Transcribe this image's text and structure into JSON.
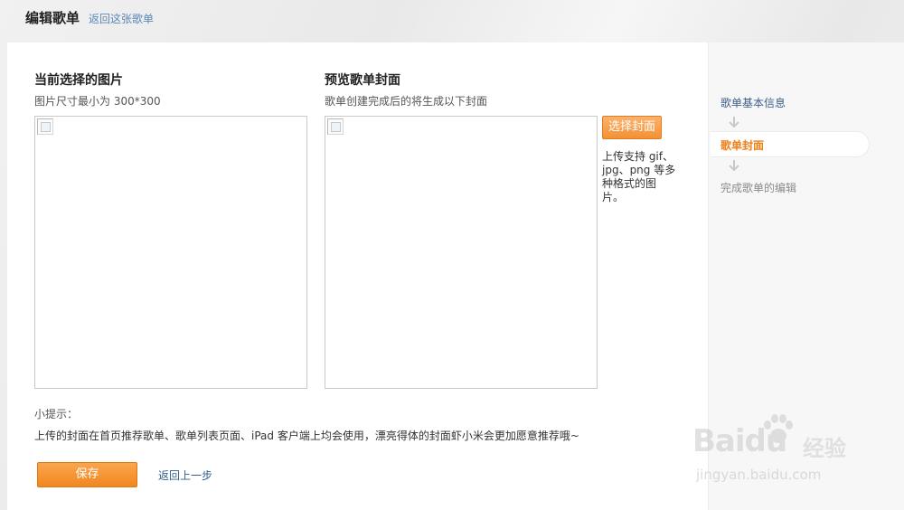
{
  "header": {
    "title": "编辑歌单",
    "back_link": "返回这张歌单"
  },
  "left_panel": {
    "title": "当前选择的图片",
    "subtitle": "图片尺寸最小为 300*300"
  },
  "right_panel": {
    "title": "预览歌单封面",
    "subtitle": "歌单创建完成后的将生成以下封面",
    "choose_button": "选择封面",
    "upload_note": "上传支持 gif、jpg、png 等多种格式的图片。"
  },
  "tips": {
    "label": "小提示：",
    "text": "上传的封面在首页推荐歌单、歌单列表页面、iPad 客户端上均会使用，漂亮得体的封面虾小米会更加愿意推荐哦~"
  },
  "actions": {
    "save": "保存",
    "back": "返回上一步"
  },
  "steps": [
    {
      "label": "歌单基本信息",
      "state": "done"
    },
    {
      "label": "歌单封面",
      "state": "current"
    },
    {
      "label": "完成歌单的编辑",
      "state": "future"
    }
  ],
  "watermark": {
    "logo": "Baidu",
    "brand": "经验",
    "url": "jingyan.baidu.com"
  },
  "colors": {
    "accent_orange": "#f39134",
    "link_blue": "#5b87b8",
    "current_step": "#f0801a"
  }
}
